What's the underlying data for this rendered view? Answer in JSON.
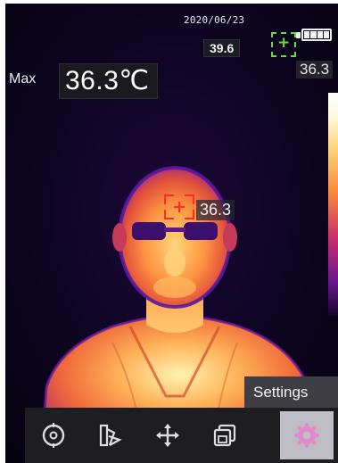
{
  "status": {
    "date": "2020/06/23",
    "ambient_temp": "39.6",
    "spot_temp": "36.3",
    "battery_level": 1.0
  },
  "max_readout": {
    "label": "Max",
    "value": "36.3℃"
  },
  "face_detection": {
    "temperature": "36.3"
  },
  "tooltip": {
    "text": "Settings"
  },
  "toolbar": {
    "items": [
      {
        "icon": "target-icon",
        "active": false
      },
      {
        "icon": "palette-icon",
        "active": false
      },
      {
        "icon": "move-icon",
        "active": false
      },
      {
        "icon": "gallery-icon",
        "active": false
      },
      {
        "icon": "gear-icon",
        "active": true,
        "tooltip": "Settings"
      }
    ]
  },
  "colors": {
    "palette": "ironbow",
    "spot_marker": "#6cdc3a",
    "face_marker": "#ff2a2a",
    "background": "#05030f"
  }
}
